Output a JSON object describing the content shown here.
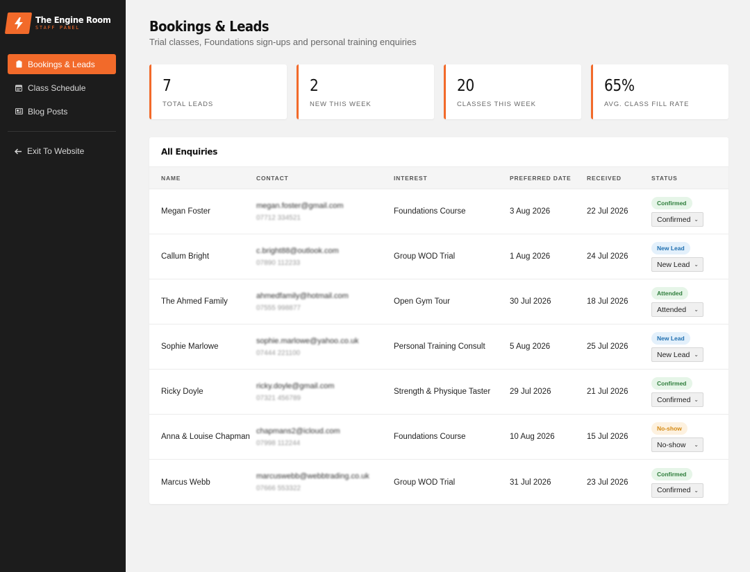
{
  "brand": {
    "title": "The Engine Room",
    "subtitle": "STAFF PANEL",
    "accent": "#f26a2a"
  },
  "sidebar": {
    "items": [
      {
        "label": "Bookings & Leads",
        "icon": "clipboard-icon",
        "active": true
      },
      {
        "label": "Class Schedule",
        "icon": "calendar-icon",
        "active": false
      },
      {
        "label": "Blog Posts",
        "icon": "newspaper-icon",
        "active": false
      }
    ],
    "exit_label": "Exit To Website"
  },
  "header": {
    "title": "Bookings & Leads",
    "subtitle": "Trial classes, Foundations sign-ups and personal training enquiries"
  },
  "stats": [
    {
      "value": "7",
      "label": "TOTAL LEADS"
    },
    {
      "value": "2",
      "label": "NEW THIS WEEK"
    },
    {
      "value": "20",
      "label": "CLASSES THIS WEEK"
    },
    {
      "value": "65%",
      "label": "AVG. CLASS FILL RATE"
    }
  ],
  "table": {
    "title": "All Enquiries",
    "columns": [
      "NAME",
      "CONTACT",
      "INTEREST",
      "PREFERRED DATE",
      "RECEIVED",
      "STATUS"
    ],
    "rows": [
      {
        "name": "Megan Foster",
        "email": "megan.foster@gmail.com",
        "phone": "07712 334521",
        "interest": "Foundations Course",
        "preferred": "3 Aug 2026",
        "received": "22 Jul 2026",
        "badge": "Confirmed",
        "status": "Confirmed"
      },
      {
        "name": "Callum Bright",
        "email": "c.bright88@outlook.com",
        "phone": "07890 112233",
        "interest": "Group WOD Trial",
        "preferred": "1 Aug 2026",
        "received": "24 Jul 2026",
        "badge": "New Lead",
        "status": "New Lead"
      },
      {
        "name": "The Ahmed Family",
        "email": "ahmedfamily@hotmail.com",
        "phone": "07555 998877",
        "interest": "Open Gym Tour",
        "preferred": "30 Jul 2026",
        "received": "18 Jul 2026",
        "badge": "Attended",
        "status": "Attended"
      },
      {
        "name": "Sophie Marlowe",
        "email": "sophie.marlowe@yahoo.co.uk",
        "phone": "07444 221100",
        "interest": "Personal Training Consult",
        "preferred": "5 Aug 2026",
        "received": "25 Jul 2026",
        "badge": "New Lead",
        "status": "New Lead"
      },
      {
        "name": "Ricky Doyle",
        "email": "ricky.doyle@gmail.com",
        "phone": "07321 456789",
        "interest": "Strength & Physique Taster",
        "preferred": "29 Jul 2026",
        "received": "21 Jul 2026",
        "badge": "Confirmed",
        "status": "Confirmed"
      },
      {
        "name": "Anna & Louise Chapman",
        "email": "chapmans2@icloud.com",
        "phone": "07998 112244",
        "interest": "Foundations Course",
        "preferred": "10 Aug 2026",
        "received": "15 Jul 2026",
        "badge": "No-show",
        "status": "No-show"
      },
      {
        "name": "Marcus Webb",
        "email": "marcuswebb@webbtrading.co.uk",
        "phone": "07666 553322",
        "interest": "Group WOD Trial",
        "preferred": "31 Jul 2026",
        "received": "23 Jul 2026",
        "badge": "Confirmed",
        "status": "Confirmed"
      }
    ]
  }
}
